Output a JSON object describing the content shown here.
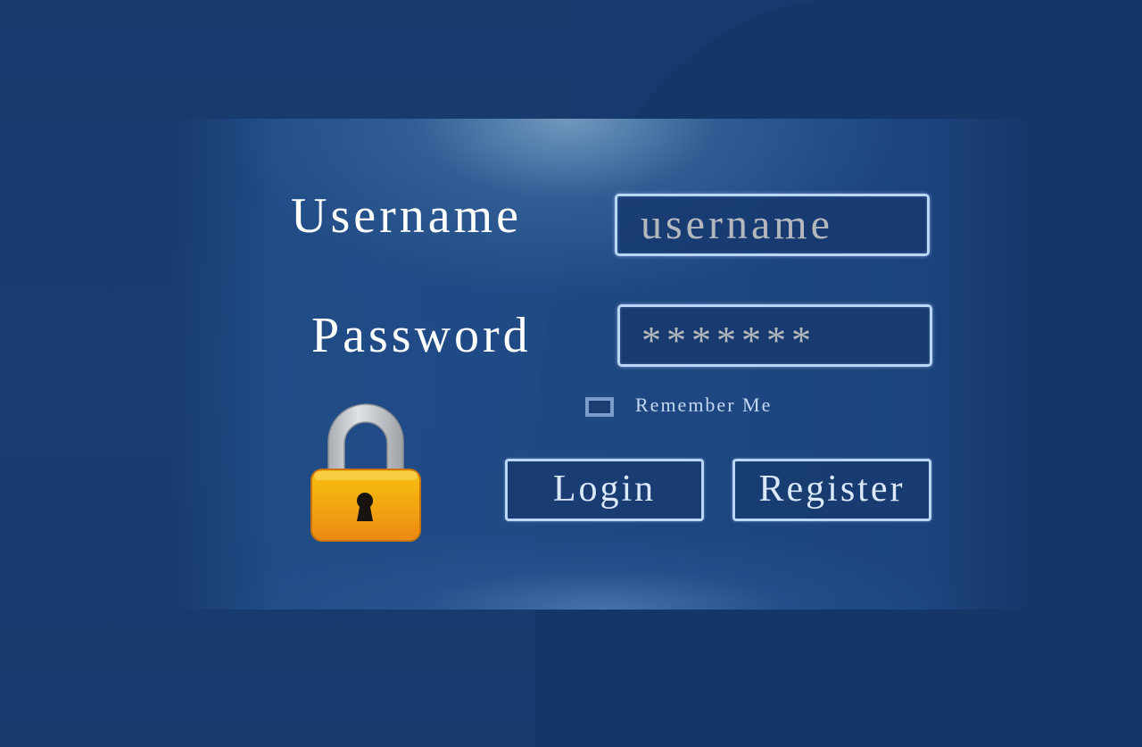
{
  "form": {
    "username_label": "Username",
    "password_label": "Password",
    "username_field": {
      "placeholder": "username",
      "value": ""
    },
    "password_field": {
      "value": "*******"
    },
    "remember_me": {
      "label": "Remember Me",
      "checked": false
    },
    "buttons": {
      "login": "Login",
      "register": "Register"
    }
  },
  "icons": {
    "lock": "padlock-icon"
  },
  "colors": {
    "background": "#173a6e",
    "field_border": "#b9d6f6",
    "lock_body": "#f5a91e",
    "lock_shackle": "#c9ccd0"
  }
}
